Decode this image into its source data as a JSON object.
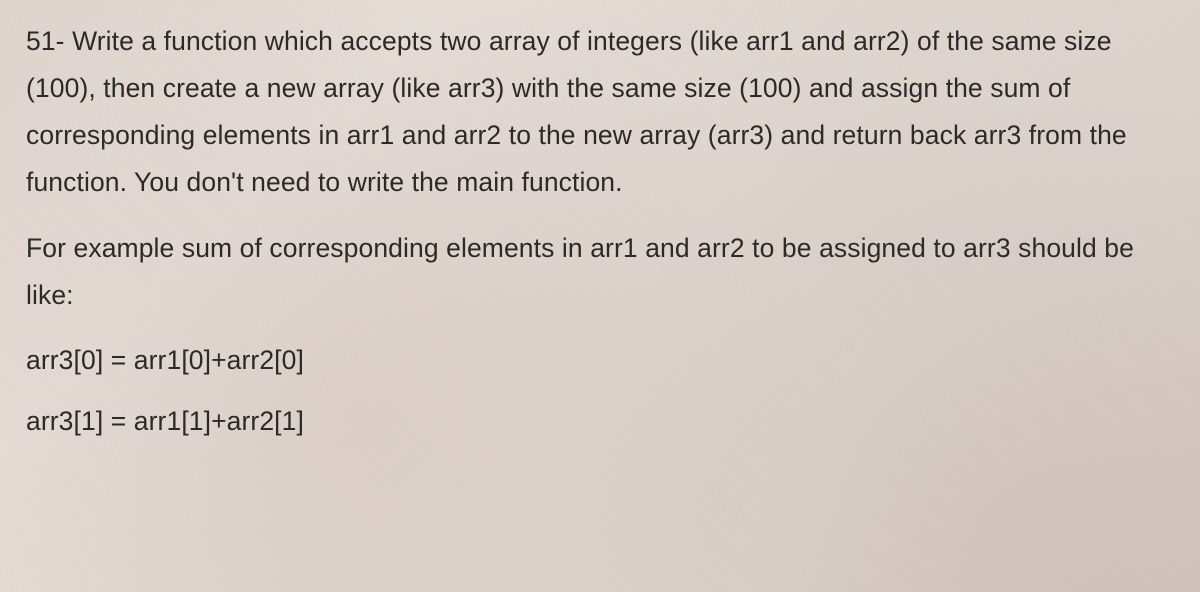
{
  "question": {
    "paragraph1": "51- Write a function which accepts two array of integers (like arr1 and arr2) of the same size (100), then create a new array (like arr3) with the same size (100) and assign the sum of corresponding elements in arr1 and arr2 to the new array (arr3) and return back arr3 from the function. You don't need to write the main function.",
    "paragraph2": "For example sum of corresponding elements in arr1 and arr2 to be assigned to arr3 should be like:",
    "equation1": "arr3[0] = arr1[0]+arr2[0]",
    "equation2": "arr3[1] = arr1[1]+arr2[1]"
  }
}
